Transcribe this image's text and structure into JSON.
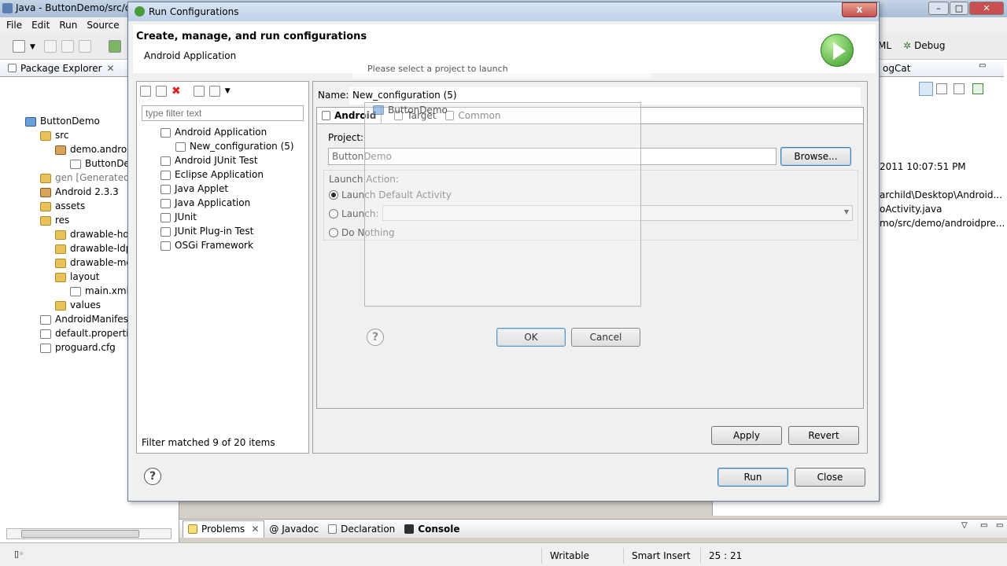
{
  "main_window": {
    "title": "Java - ButtonDemo/src/de",
    "menu": [
      "File",
      "Edit",
      "Run",
      "Source"
    ],
    "perspectives": {
      "xml_label": "ML",
      "debug_label": "Debug"
    }
  },
  "package_explorer": {
    "title": "Package Explorer",
    "tree": [
      {
        "label": "ButtonDemo",
        "icon": "project-icon",
        "depth": 0
      },
      {
        "label": "src",
        "icon": "folder-icon",
        "depth": 1
      },
      {
        "label": "demo.android",
        "icon": "package-icon",
        "depth": 2
      },
      {
        "label": "ButtonDem",
        "icon": "java-file-icon",
        "depth": 3
      },
      {
        "label": "gen [Generated J",
        "icon": "folder-icon",
        "depth": 1
      },
      {
        "label": "Android 2.3.3",
        "icon": "library-icon",
        "depth": 1
      },
      {
        "label": "assets",
        "icon": "folder-icon",
        "depth": 1
      },
      {
        "label": "res",
        "icon": "folder-icon",
        "depth": 1
      },
      {
        "label": "drawable-hdp",
        "icon": "folder-icon",
        "depth": 2
      },
      {
        "label": "drawable-ldp",
        "icon": "folder-icon",
        "depth": 2
      },
      {
        "label": "drawable-md",
        "icon": "folder-icon",
        "depth": 2
      },
      {
        "label": "layout",
        "icon": "folder-icon",
        "depth": 2
      },
      {
        "label": "main.xml",
        "icon": "xml-file-icon",
        "depth": 3
      },
      {
        "label": "values",
        "icon": "folder-icon",
        "depth": 2
      },
      {
        "label": "AndroidManifest",
        "icon": "file-icon",
        "depth": 1
      },
      {
        "label": "default.properties",
        "icon": "file-icon",
        "depth": 1
      },
      {
        "label": "proguard.cfg",
        "icon": "file-icon",
        "depth": 1
      }
    ]
  },
  "right_panel": {
    "tab": "ogCat",
    "lines": [
      "2011 10:07:51 PM",
      "archild\\Desktop\\Android...",
      "oActivity.java",
      "mo/src/demo/androidpre..."
    ]
  },
  "bottom_tabs": [
    "Problems",
    "@ Javadoc",
    "Declaration",
    "Console"
  ],
  "status_bar": {
    "mode": "Writable",
    "insert": "Smart Insert",
    "position": "25 : 21"
  },
  "dialog": {
    "title": "Run Configurations",
    "heading": "Create, manage, and run configurations",
    "subheading": "Android Application",
    "filter_placeholder": "type filter text",
    "config_tree": [
      {
        "label": "Android Application",
        "depth": 0,
        "icon": "android-app-icon"
      },
      {
        "label": "New_configuration (5)",
        "depth": 1,
        "icon": "launch-config-icon"
      },
      {
        "label": "Android JUnit Test",
        "depth": 0,
        "icon": "junit-icon"
      },
      {
        "label": "Eclipse Application",
        "depth": 0,
        "icon": "eclipse-icon"
      },
      {
        "label": "Java Applet",
        "depth": 0,
        "icon": "applet-icon"
      },
      {
        "label": "Java Application",
        "depth": 0,
        "icon": "java-app-icon"
      },
      {
        "label": "JUnit",
        "depth": 0,
        "icon": "junit-icon"
      },
      {
        "label": "JUnit Plug-in Test",
        "depth": 0,
        "icon": "junit-icon"
      },
      {
        "label": "OSGi Framework",
        "depth": 0,
        "icon": "osgi-icon"
      }
    ],
    "filter_status": "Filter matched 9 of 20 items",
    "name_label": "Name:",
    "name_value": "New_configuration (5)",
    "tabs": [
      "Android",
      "Target",
      "Common"
    ],
    "project_label": "Project:",
    "project_value": "ButtonDemo",
    "browse_label": "Browse...",
    "launch_action_label": "Launch Action:",
    "radio_default": "Launch Default Activity",
    "radio_launch": "Launch:",
    "radio_nothing": "Do Nothing",
    "apply_label": "Apply",
    "revert_label": "Revert",
    "run_label": "Run",
    "close_label": "Close",
    "close_x": "x"
  },
  "project_selection": {
    "message": "Please select a project to launch",
    "project_item": "ButtonDemo",
    "ok_label": "OK",
    "cancel_label": "Cancel"
  }
}
